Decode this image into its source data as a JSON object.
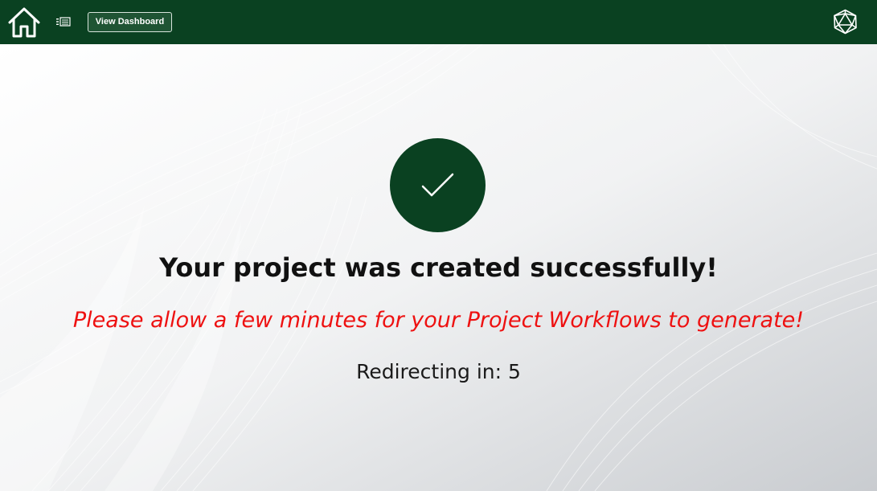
{
  "topbar": {
    "home_icon": "home-icon",
    "list_icon": "list-icon",
    "dashboard_button_label": "View Dashboard",
    "logo_icon": "polyhedron-logo-icon",
    "background_color": "#0a4121"
  },
  "main": {
    "status_icon": "check-icon",
    "title": "Your project was created successfully!",
    "note": "Please allow a few minutes for your Project Workflows to generate!",
    "redirect_label": "Redirecting in:",
    "redirect_count": "5",
    "accent_color": "#0a4121",
    "note_color": "#ee1111"
  }
}
